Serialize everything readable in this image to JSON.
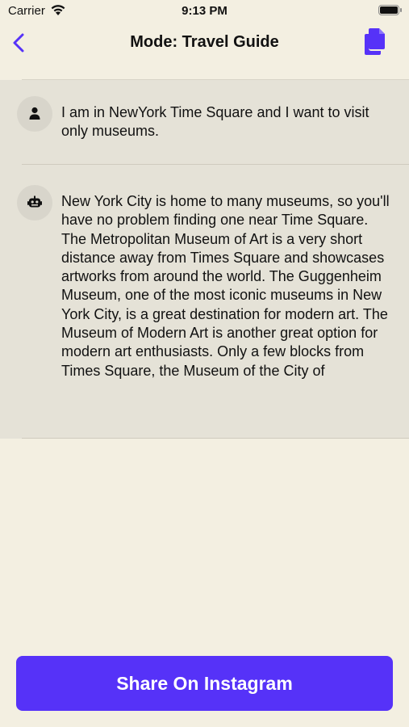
{
  "status_bar": {
    "carrier": "Carrier",
    "time": "9:13 PM"
  },
  "nav": {
    "title": "Mode: Travel Guide",
    "back_icon": "chevron-left-icon",
    "copy_icon": "copy-document-icon"
  },
  "messages": [
    {
      "role": "user",
      "avatar_icon": "person-icon",
      "text": "I am in NewYork Time Square and I want to visit only museums."
    },
    {
      "role": "bot",
      "avatar_icon": "robot-icon",
      "text": "New York City is home to many museums, so you'll have no problem finding one near Time Square. The Metropolitan Museum of Art is a very short distance away from Times Square and showcases artworks from around the world. The Guggenheim Museum, one of the most iconic museums in New York City, is a great destination for modern art. The Museum of Modern Art is another great option for modern art enthusiasts. Only a few blocks from Times Square, the Museum of the City of"
    }
  ],
  "share_button": {
    "label": "Share On Instagram"
  },
  "colors": {
    "background": "#f3efe1",
    "message_background": "#e5e2d7",
    "accent": "#5632f8"
  }
}
